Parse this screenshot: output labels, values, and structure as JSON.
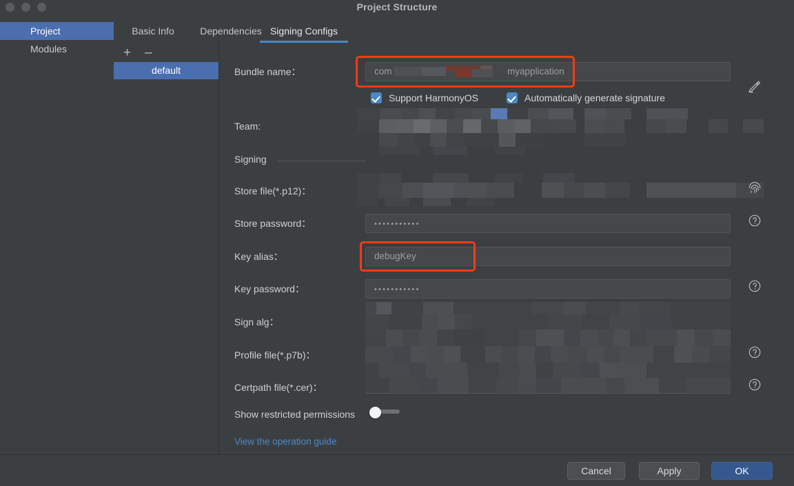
{
  "window": {
    "title": "Project Structure",
    "traffic_lights": [
      "close-button",
      "minimize-button",
      "zoom-button"
    ]
  },
  "sidebar": {
    "items": [
      {
        "label": "Project",
        "selected": true
      },
      {
        "label": "Modules",
        "selected": false
      }
    ]
  },
  "tabs": [
    {
      "label": "Basic Info",
      "active": false
    },
    {
      "label": "Dependencies",
      "active": false
    },
    {
      "label": "Signing Configs",
      "active": true
    }
  ],
  "config_list": {
    "add_label": "+",
    "remove_label": "–",
    "items": [
      {
        "label": "default",
        "selected": true
      }
    ]
  },
  "form": {
    "bundle_name": {
      "label": "Bundle name：",
      "value_prefix": "com",
      "value_suffix": "myapplication",
      "redacted": true,
      "highlighted": true
    },
    "checkboxes": [
      {
        "label": "Support HarmonyOS",
        "checked": true
      },
      {
        "label": "Automatically generate signature",
        "checked": true
      }
    ],
    "team": {
      "label": "Team:",
      "value": "",
      "redacted": true
    },
    "signing_section": {
      "label": "Signing"
    },
    "store_file": {
      "label": "Store file(*.p12)：",
      "value": "",
      "redacted": true
    },
    "store_password": {
      "label": "Store password：",
      "value": "•••••••••••"
    },
    "key_alias": {
      "label": "Key alias：",
      "value": "debugKey",
      "highlighted": true
    },
    "key_password": {
      "label": "Key password：",
      "value": "•••••••••••"
    },
    "sign_alg": {
      "label": "Sign alg：",
      "value": "",
      "redacted": true
    },
    "profile_file": {
      "label": "Profile file(*.p7b)：",
      "value": "",
      "redacted": true
    },
    "certpath_file": {
      "label": "Certpath file(*.cer)：",
      "value": "",
      "redacted": true
    },
    "show_restricted": {
      "label": "Show restricted permissions",
      "enabled": false
    },
    "guide_link": {
      "label": "View the operation guide"
    }
  },
  "icons": {
    "edit": "pencil-icon",
    "fingerprint": "fingerprint-icon",
    "help": "help-circle-icon"
  },
  "footer": {
    "cancel": "Cancel",
    "apply": "Apply",
    "ok": "OK"
  },
  "colors": {
    "accent": "#4a88c7",
    "selection": "#4b6eaf",
    "highlight": "#f93a15",
    "background": "#3c3f41",
    "primary_button": "#35588f"
  }
}
